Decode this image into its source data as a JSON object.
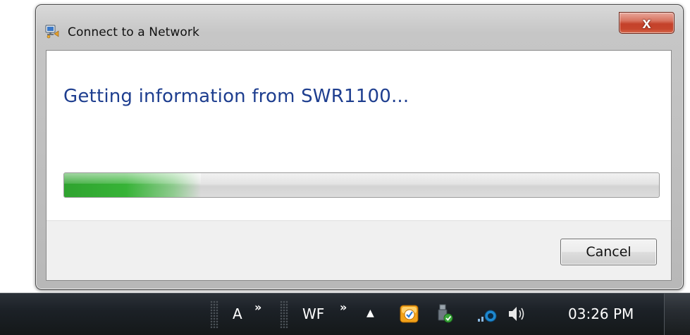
{
  "window": {
    "title": "Connect to a Network",
    "close_label": "x",
    "icon": "network-connect-icon"
  },
  "main": {
    "heading": "Getting information from SWR1100...",
    "progress_percent": 23
  },
  "footer": {
    "cancel_label": "Cancel"
  },
  "taskbar": {
    "toolbar1_label": "A",
    "toolbar1_chevron": "»",
    "toolbar2_label": "WF",
    "toolbar2_chevron": "»",
    "tray_expand": "▲",
    "tray_icons": [
      "outlook-icon",
      "usb-safely-remove-icon",
      "network-icon",
      "volume-icon"
    ],
    "clock": "03:26 PM"
  },
  "colors": {
    "heading": "#1e3e8f",
    "progress_fill": "#37b337",
    "close_button": "#c4412a",
    "taskbar": "#1c2127"
  }
}
